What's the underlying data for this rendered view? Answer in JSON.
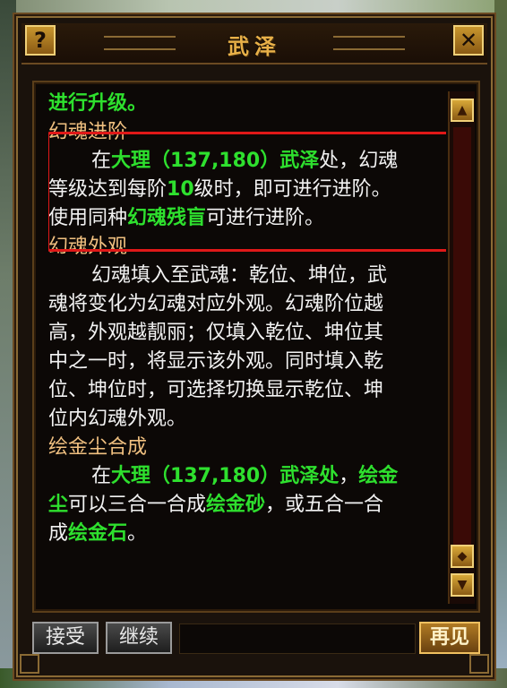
{
  "window": {
    "title": "武泽"
  },
  "icons": {
    "help": "question-icon",
    "close": "close-x-icon"
  },
  "content": {
    "line1": "进行升级。",
    "sec1_heading": "幻魂进阶",
    "sec1": {
      "l1_a": "在",
      "l1_b": "大理（137,180）武泽",
      "l1_c": "处，幻魂",
      "l2_a": "等级达到每阶",
      "l2_b": "10",
      "l2_c": "级时，即可进行进阶。",
      "l3_a": "使用同种",
      "l3_b": "幻魂残盲",
      "l3_c": "可进行进阶。"
    },
    "sec2_heading": "幻魂外观",
    "sec2": {
      "l1": "幻魂填入至武魂：乾位、坤位，武",
      "l2": "魂将变化为幻魂对应外观。幻魂阶位越",
      "l3": "高，外观越靓丽；仅填入乾位、坤位其",
      "l4": "中之一时，将显示该外观。同时填入乾",
      "l5": "位、坤位时，可选择切换显示乾位、坤",
      "l6": "位内幻魂外观。"
    },
    "sec3_heading": "绘金尘合成",
    "sec3": {
      "l1_a": "在",
      "l1_b": "大理（137,180）武泽处",
      "l1_c": "，",
      "l1_d": "绘金",
      "l2_a": "尘",
      "l2_b": "可以三合一合成",
      "l2_c": "绘金砂",
      "l2_d": "，或五合一合",
      "l3_a": "成",
      "l3_b": "绘金石",
      "l3_c": "。"
    }
  },
  "buttons": {
    "accept": "接受",
    "continue": "继续",
    "goodbye": "再见"
  },
  "colors": {
    "highlight": "#e01818",
    "npc_green": "#2ee02e",
    "heading": "#f0c080",
    "title": "#e8b048"
  }
}
